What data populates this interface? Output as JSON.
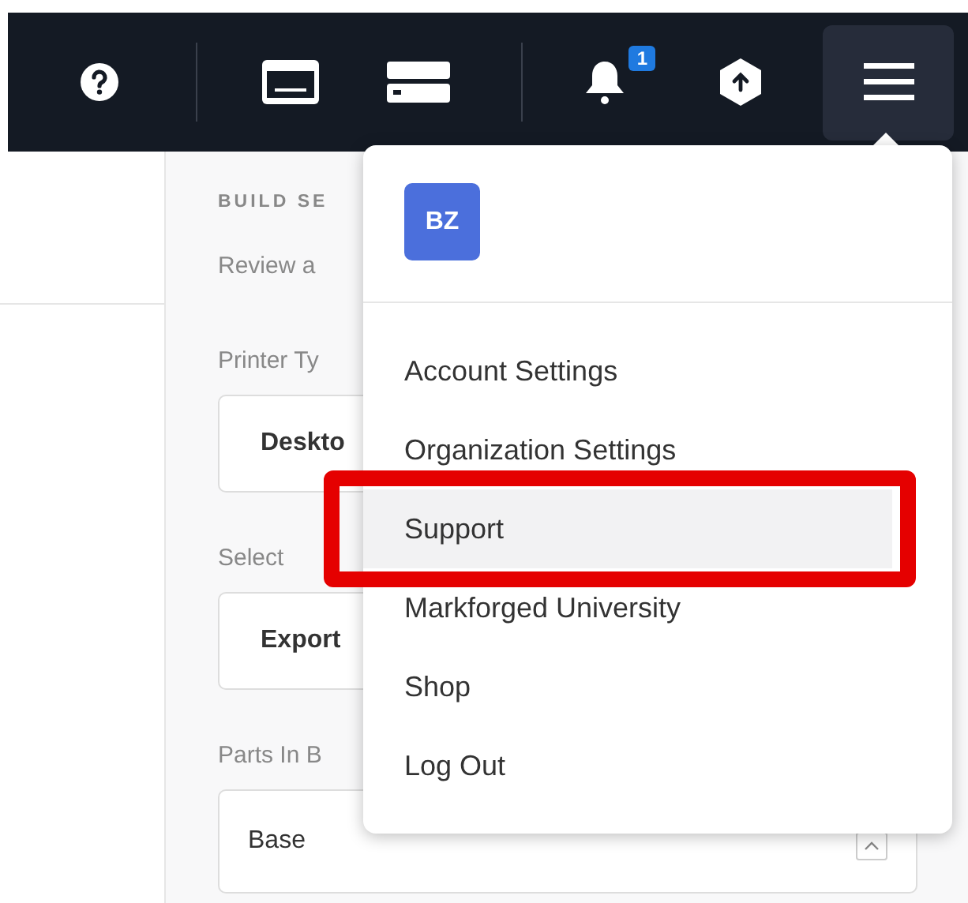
{
  "nav": {
    "notification_badge": "1",
    "menu_open": true
  },
  "form": {
    "section_heading": "BUILD SE",
    "description": "Review a",
    "fields": [
      {
        "label": "Printer Ty",
        "value": "Deskto",
        "kind": "select"
      },
      {
        "label": "Select",
        "value": "Export",
        "kind": "select"
      },
      {
        "label": "Parts In B",
        "value": "Base",
        "kind": "multiselect"
      }
    ]
  },
  "menu": {
    "avatar": "BZ",
    "items": [
      {
        "label": "Account Settings",
        "selected": false
      },
      {
        "label": "Organization Settings",
        "selected": false
      },
      {
        "label": "Support",
        "selected": true
      },
      {
        "label": "Markforged University",
        "selected": false
      },
      {
        "label": "Shop",
        "selected": false
      },
      {
        "label": "Log Out",
        "selected": false
      }
    ]
  }
}
